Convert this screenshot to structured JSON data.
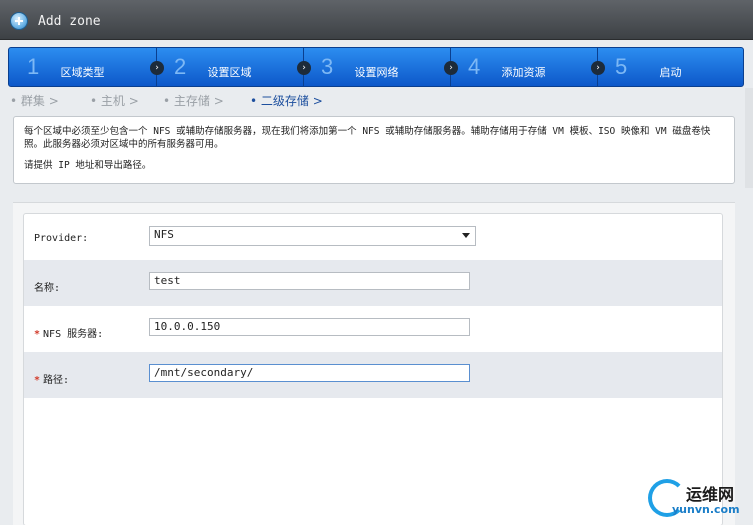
{
  "window": {
    "title": "Add zone"
  },
  "steps": [
    {
      "num": "1",
      "label": "区域类型"
    },
    {
      "num": "2",
      "label": "设置区域"
    },
    {
      "num": "3",
      "label": "设置网络"
    },
    {
      "num": "4",
      "label": "添加资源"
    },
    {
      "num": "5",
      "label": "启动"
    }
  ],
  "substeps": [
    {
      "label": "• 群集 >"
    },
    {
      "label": "• 主机 >"
    },
    {
      "label": "• 主存储 >"
    },
    {
      "label": "• 二级存储 >",
      "active": true
    }
  ],
  "info": {
    "line1": "每个区域中必须至少包含一个 NFS 或辅助存储服务器，现在我们将添加第一个 NFS 或辅助存储服务器。辅助存储用于存储 VM 模板、ISO 映像和 VM 磁盘卷快照。此服务器必须对区域中的所有服务器可用。",
    "line2": "请提供 IP 地址和导出路径。"
  },
  "form": {
    "provider": {
      "label": "Provider:",
      "value": "NFS"
    },
    "name": {
      "label": "名称:",
      "value": "test"
    },
    "nfs_server": {
      "label": "NFS 服务器:",
      "value": "10.0.0.150",
      "required_mark": "*"
    },
    "path": {
      "label": "路径:",
      "value": "/mnt/secondary/",
      "required_mark": "*"
    }
  },
  "watermark": {
    "text1": "运维网",
    "text2": "yunvn.com"
  },
  "colors": {
    "accent": "#0d58c9",
    "required": "#d23b2b"
  }
}
